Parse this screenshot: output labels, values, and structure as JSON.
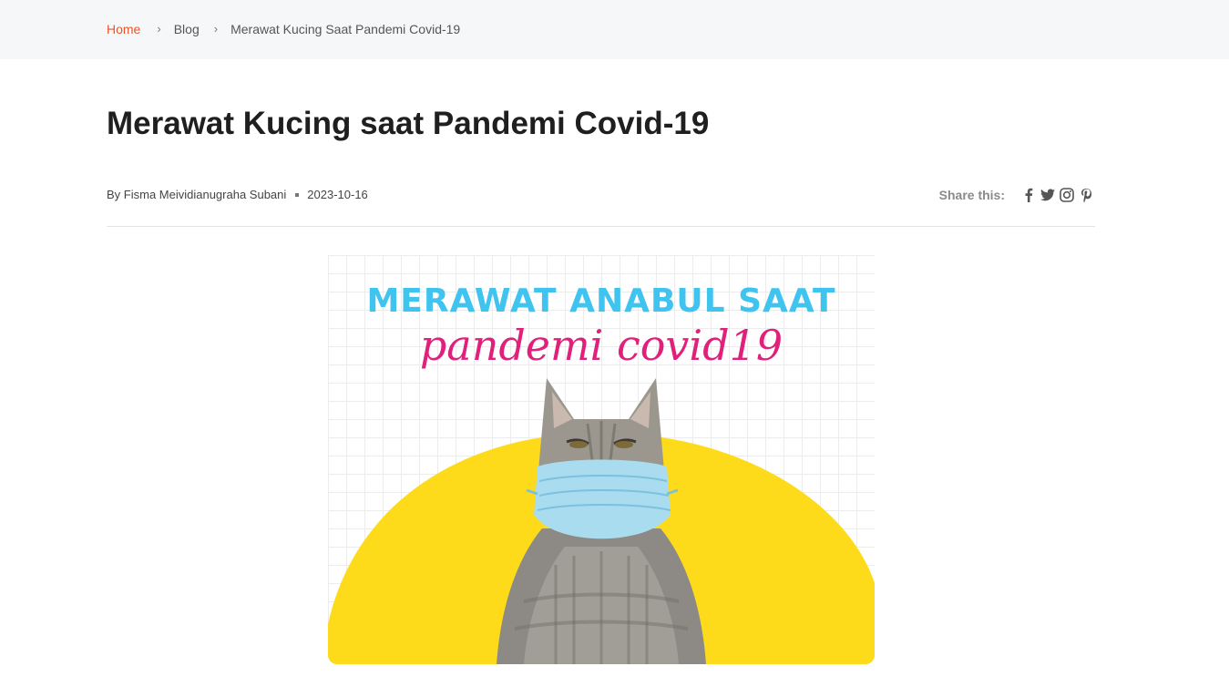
{
  "breadcrumb": {
    "home": "Home",
    "blog": "Blog",
    "current": "Merawat Kucing Saat Pandemi Covid-19",
    "separator": "›"
  },
  "article": {
    "title": "Merawat Kucing saat Pandemi Covid-19",
    "author": "By Fisma Meividianugraha Subani",
    "date": "2023-10-16"
  },
  "share": {
    "label": "Share this:",
    "icons": [
      "facebook-icon",
      "twitter-icon",
      "instagram-icon",
      "pinterest-icon"
    ]
  },
  "hero": {
    "headline": "MERAWAT ANABUL SAAT",
    "script": "pandemi covid19"
  },
  "colors": {
    "accent": "#e4572e",
    "headline": "#3fc3ef",
    "script": "#e0207a",
    "sun": "#fddb1a",
    "mask": "#a9dcef"
  }
}
